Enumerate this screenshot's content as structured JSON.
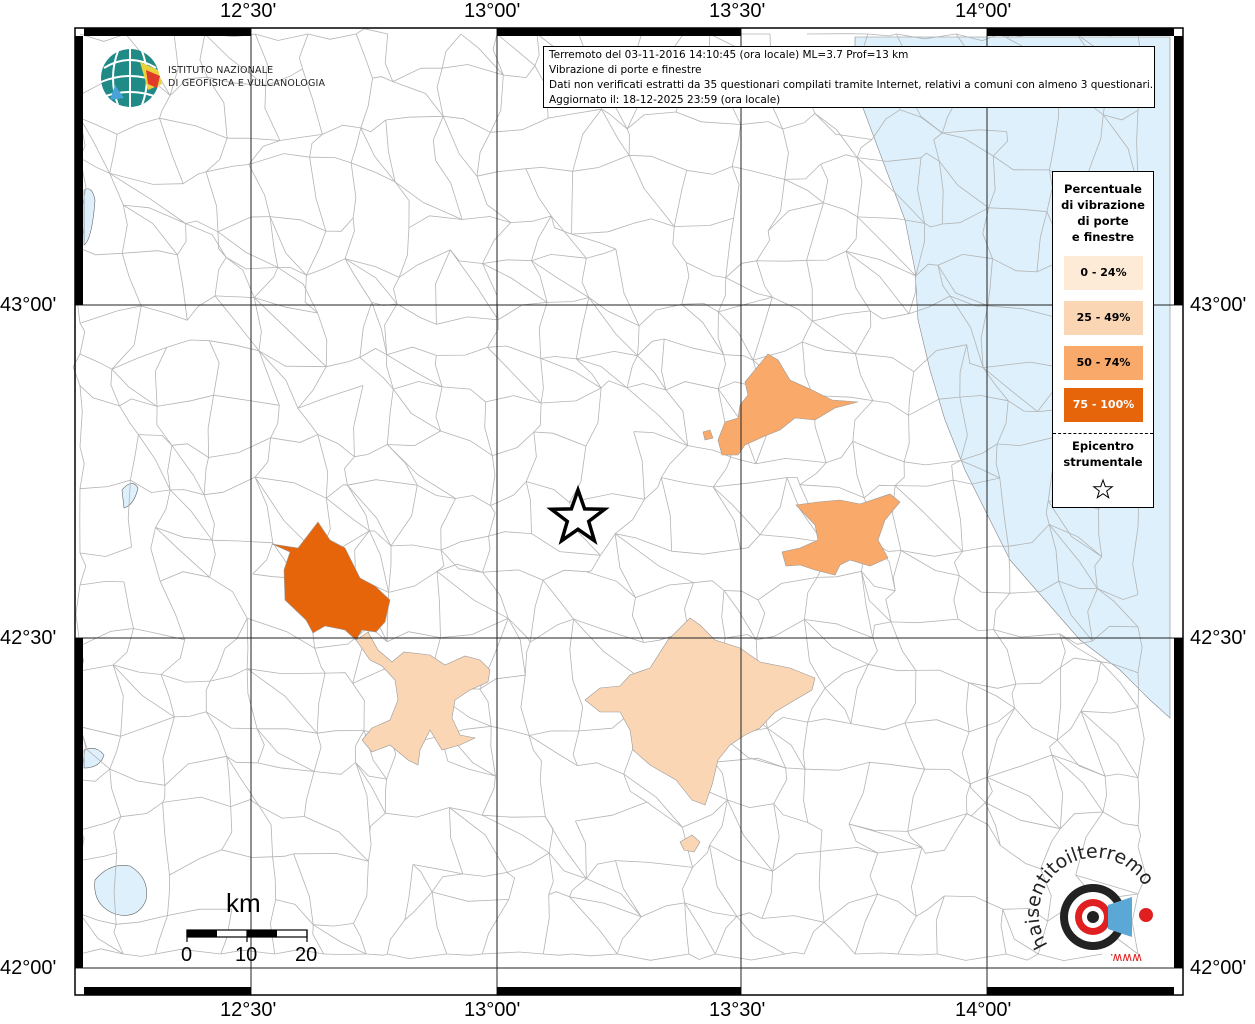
{
  "map": {
    "info_box": {
      "line1": "Terremoto del 03-11-2016 14:10:45 (ora locale) ML=3.7 Prof=13 km",
      "line2": "Vibrazione di porte e finestre",
      "line3": "Dati non verificati estratti da 35 questionari compilati tramite Internet, relativi a comuni con almeno 3 questionari.",
      "line4": "Aggiornato il: 18-12-2025 23:59 (ora locale)"
    },
    "lon_labels": [
      "12°30'",
      "13°00'",
      "13°30'",
      "14°00'"
    ],
    "lat_labels": [
      "43°00'",
      "42°30'",
      "42°00'"
    ],
    "logo": {
      "line1": "ISTITUTO NAZIONALE",
      "line2": "DI GEOFISICA E VULCANOLOGIA"
    },
    "legend": {
      "title_lines": [
        "Percentuale",
        "di vibrazione",
        "di porte",
        "e finestre"
      ],
      "classes": [
        {
          "label": "0 - 24%",
          "color": "#fdebd8"
        },
        {
          "label": "25 - 49%",
          "color": "#fbd6b5"
        },
        {
          "label": "50 - 74%",
          "color": "#f9aa6a"
        },
        {
          "label": "75 - 100%",
          "color": "#e6650a"
        }
      ],
      "epicenter_lines": [
        "Epicentro",
        "strumentale"
      ]
    },
    "scale": {
      "unit": "km",
      "ticks": [
        "0",
        "10",
        "20"
      ]
    },
    "watermark": {
      "text": "haisentitoilterremoto.it",
      "url": "www."
    },
    "colors": {
      "sea": "#ddf0fb",
      "boundary": "#b4b4b4"
    }
  }
}
